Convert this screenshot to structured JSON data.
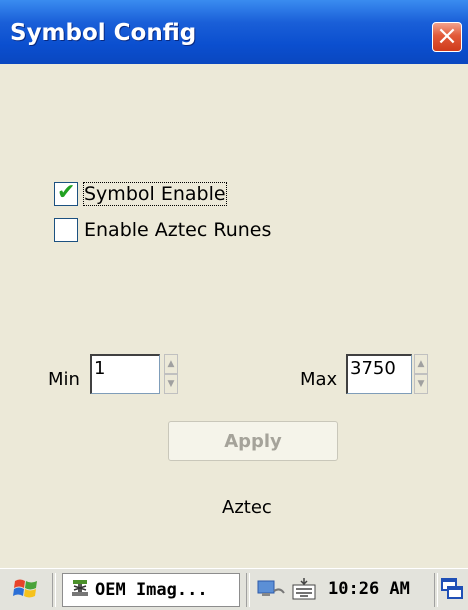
{
  "window": {
    "title": "Symbol Config",
    "close_glyph": "×"
  },
  "options": {
    "symbol_enable": {
      "label": "Symbol Enable",
      "checked": true
    },
    "enable_aztec_runes": {
      "label": "Enable Aztec Runes",
      "checked": false
    }
  },
  "range": {
    "min_label": "Min",
    "min_value": "1",
    "max_label": "Max",
    "max_value": "3750"
  },
  "apply_label": "Apply",
  "symbology_name": "Aztec",
  "taskbar": {
    "start_icon": "windows-flag-icon",
    "task_label": "OEM Imag...",
    "task_icon": "imager-app-icon",
    "network_icon": "network-icon",
    "keyboard_icon": "keyboard-icon",
    "clock": "10:26 AM",
    "desktop_icon": "switch-windows-icon"
  },
  "colors": {
    "titlebar": "#0b4fcf",
    "close_button": "#e25a39",
    "background": "#ece9d8",
    "check_mark": "#21a121"
  }
}
